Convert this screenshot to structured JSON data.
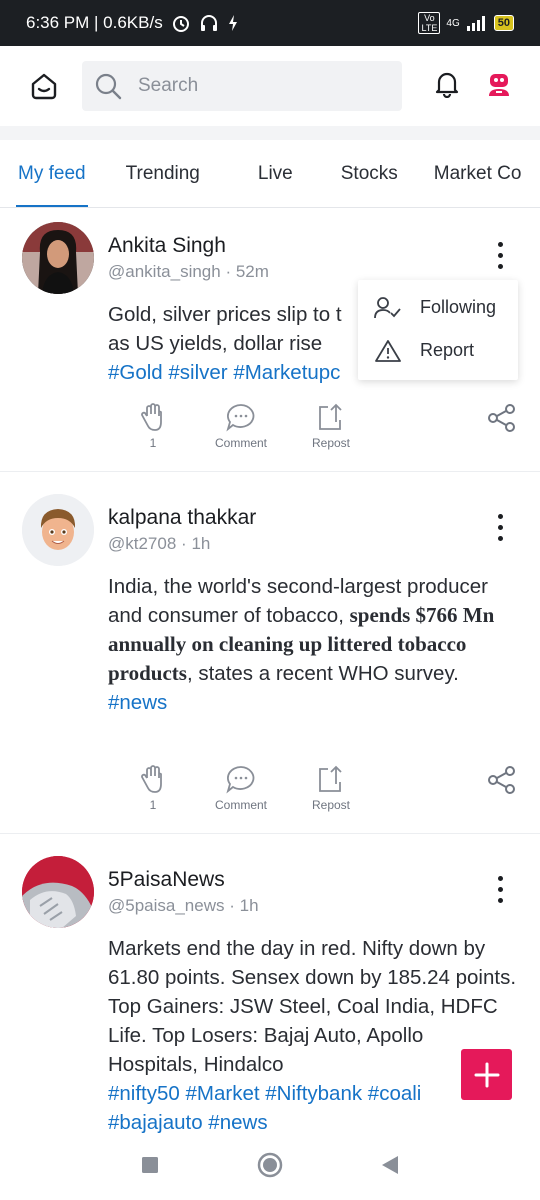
{
  "status_bar": {
    "time_speed": "6:36 PM | 0.6KB/s",
    "network": "4G",
    "volte": "Vo LTE",
    "battery": "50"
  },
  "header": {
    "search_placeholder": "Search"
  },
  "tabs": [
    {
      "label": "My feed",
      "active": true
    },
    {
      "label": "Trending",
      "active": false
    },
    {
      "label": "Live",
      "active": false
    },
    {
      "label": "Stocks",
      "active": false
    },
    {
      "label": "Market Co",
      "active": false
    }
  ],
  "posts": [
    {
      "author": "Ankita Singh",
      "handle": "@ankita_singh",
      "time": "52m",
      "text_lines": [
        "Gold, silver prices slip to t",
        "as US yields, dollar rise"
      ],
      "hashtags": "#Gold #silver #Marketupc",
      "claps": "1",
      "comment_label": "Comment",
      "repost_label": "Repost"
    },
    {
      "author": "kalpana thakkar",
      "handle": "@kt2708",
      "time": "1h",
      "text_a": "India, the world's second-largest producer and consumer of tobacco, ",
      "text_bold": "spends $766 Mn annually on cleaning up littered tobacco products",
      "text_b": ", states a recent WHO survey.",
      "hashtags": "#news",
      "claps": "1",
      "comment_label": "Comment",
      "repost_label": "Repost"
    },
    {
      "author": "5PaisaNews",
      "handle": "@5paisa_news",
      "time": "1h",
      "text": "Markets end the day in red. Nifty down by 61.80 points. Sensex down by 185.24 points. Top Gainers: JSW Steel, Coal India, HDFC Life. Top Losers: Bajaj Auto, Apollo Hospitals, Hindalco",
      "hashtags_line1": "#nifty50 #Market #Niftybank #coali",
      "hashtags_line2": "#bajajauto #news"
    }
  ],
  "dropdown": {
    "items": [
      {
        "label": "Following",
        "icon": "user-check-icon"
      },
      {
        "label": "Report",
        "icon": "warning-icon"
      }
    ]
  },
  "colors": {
    "accent": "#1673c7",
    "fab": "#e5195a",
    "status_bar": "#1c1f23"
  }
}
